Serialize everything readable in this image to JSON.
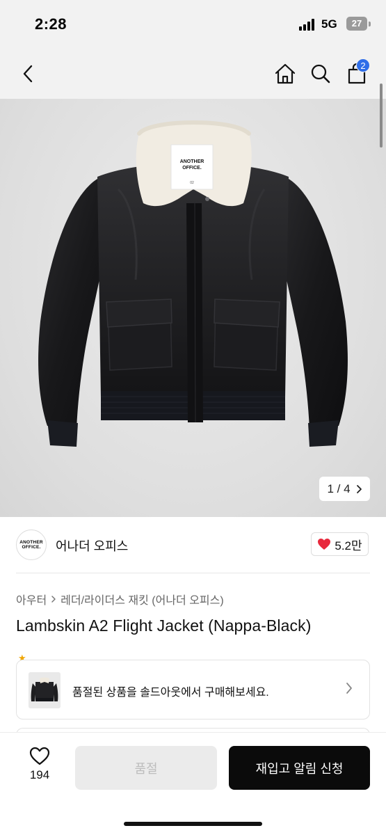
{
  "status_bar": {
    "time": "2:28",
    "network": "5G",
    "battery": "27"
  },
  "nav": {
    "back_icon": "chevron-left-icon",
    "home_icon": "home-icon",
    "search_icon": "search-icon",
    "cart_icon": "shopping-bag-icon",
    "cart_count": "2"
  },
  "gallery": {
    "tag_line1": "ANOTHER",
    "tag_line2": "OFFICE.",
    "tag_size": "02",
    "counter_text": "1 / 4",
    "next_icon": "chevron-right-icon"
  },
  "brand": {
    "logo_line1": "ANOTHER",
    "logo_line2": "OFFICE.",
    "name": "어나더 오피스",
    "like_icon": "heart-icon",
    "like_count": "5.2만"
  },
  "category": {
    "primary": "아우터",
    "secondary": "레더/라이더스 재킷 (어나더 오피스)"
  },
  "product": {
    "title": "Lambskin A2 Flight Jacket (Nappa-Black)"
  },
  "soldout_banner": {
    "text": "품절된 상품을 솔드아웃에서 구매해보세요.",
    "chevron_icon": "chevron-right-icon"
  },
  "action_bar": {
    "wish_icon": "heart-outline-icon",
    "wish_count": "194",
    "soldout_label": "품절",
    "restock_label": "재입고 알림 신청"
  },
  "colors": {
    "accent_badge": "#2f6ee8",
    "like_heart": "#e8283c",
    "primary_button": "#0b0b0b",
    "disabled_button": "#ebebeb"
  }
}
